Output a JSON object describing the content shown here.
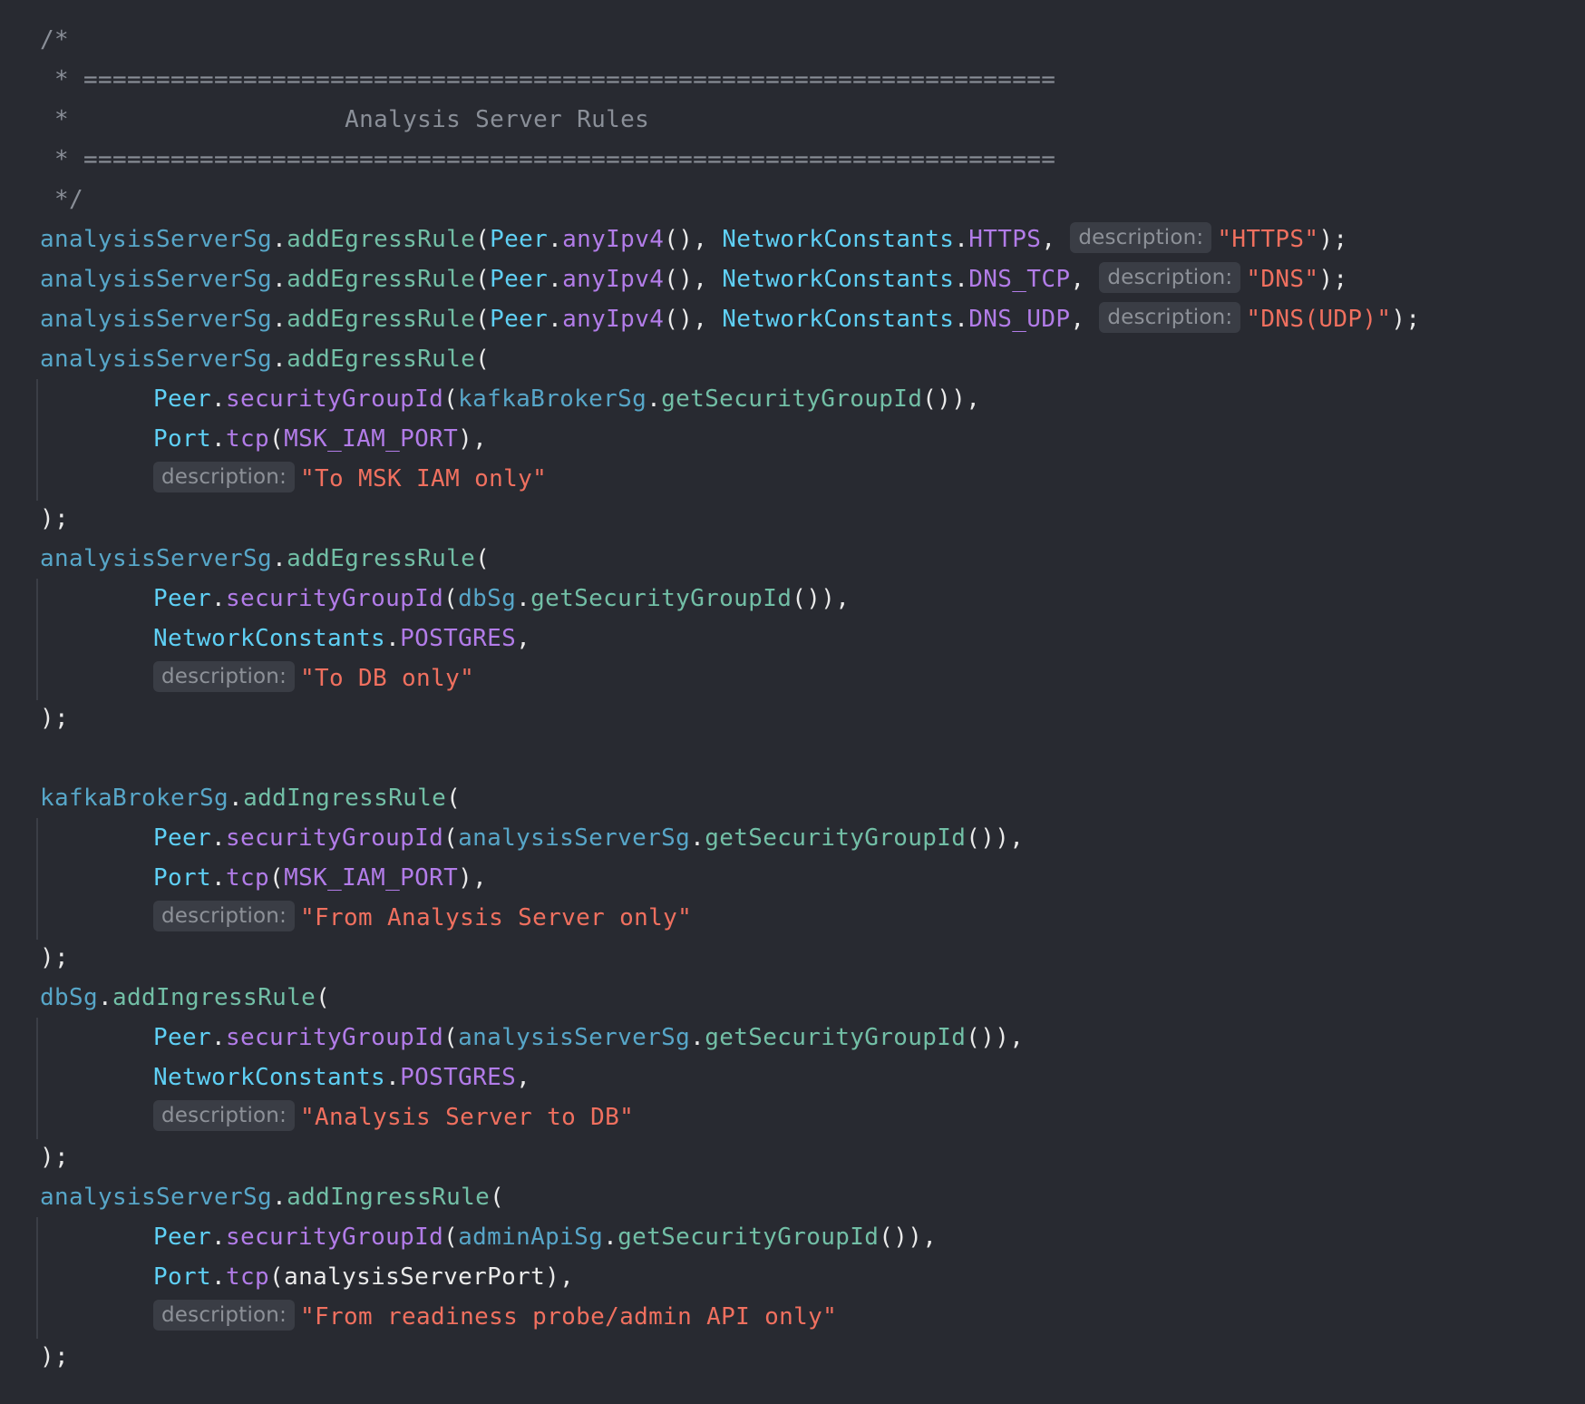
{
  "header_comment": {
    "open": "/*",
    "rule_top": " * ===================================================================",
    "title_line": " *                   Analysis Server Rules",
    "rule_bottom": " * ===================================================================",
    "close": " */"
  },
  "tok": {
    "analysisServerSg": "analysisServerSg",
    "kafkaBrokerSg": "kafkaBrokerSg",
    "dbSg": "dbSg",
    "adminApiSg": "adminApiSg",
    "dot": ".",
    "addEgressRule": "addEgressRule",
    "addIngressRule": "addIngressRule",
    "paren_open": "(",
    "Peer": "Peer",
    "anyIpv4": "anyIpv4",
    "call_sep": "(), ",
    "NetworkConstants": "NetworkConstants",
    "HTTPS": "HTTPS",
    "DNS_TCP": "DNS_TCP",
    "DNS_UDP": "DNS_UDP",
    "POSTGRES": "POSTGRES",
    "comma": ",",
    "comma_sp": ", ",
    "end_stmt": ");",
    "securityGroupId": "securityGroupId",
    "getSecurityGroupId": "getSecurityGroupId",
    "close_call_comma": "()),",
    "Port": "Port",
    "tcp": "tcp",
    "MSK_IAM_PORT": "MSK_IAM_PORT",
    "analysisServerPort": "analysisServerPort",
    "close_comma": "),",
    "hint_description": "description:"
  },
  "strings": {
    "https": "\"HTTPS\"",
    "dns": "\"DNS\"",
    "dns_udp": "\"DNS(UDP)\"",
    "msk": "\"To MSK IAM only\"",
    "db": "\"To DB only\"",
    "from_analysis": "\"From Analysis Server only\"",
    "analysis_to_db": "\"Analysis Server to DB\"",
    "readiness": "\"From readiness probe/admin API only\""
  }
}
